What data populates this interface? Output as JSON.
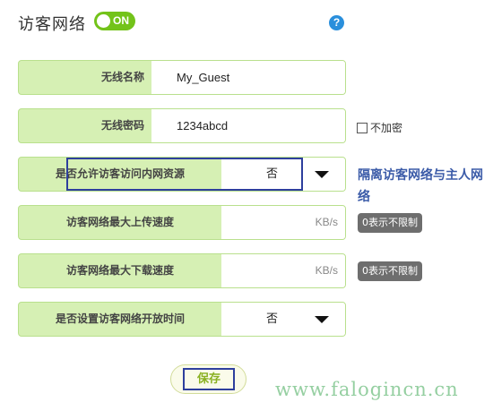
{
  "header": {
    "title": "访客网络",
    "toggle_label": "ON",
    "help_icon": "?"
  },
  "fields": {
    "ssid": {
      "label": "无线名称",
      "value": "My_Guest"
    },
    "password": {
      "label": "无线密码",
      "value": "1234abcd"
    },
    "allow_lan": {
      "label": "是否允许访客访问内网资源",
      "value": "否"
    },
    "upload": {
      "label": "访客网络最大上传速度",
      "value": "",
      "unit": "KB/s",
      "hint": "0表示不限制"
    },
    "download": {
      "label": "访客网络最大下载速度",
      "value": "",
      "unit": "KB/s",
      "hint": "0表示不限制"
    },
    "schedule": {
      "label": "是否设置访客网络开放时间",
      "value": "否"
    }
  },
  "no_encryption": {
    "label": "不加密",
    "checked": false
  },
  "side_note": "隔离访客网络与主人网络",
  "save_label": "保存",
  "watermark": "www.falogincn.cn",
  "colors": {
    "accent_green": "#73c31a",
    "row_green": "#d6f0b4",
    "frame_blue": "#2e3f9d",
    "note_blue": "#3b5ba8"
  }
}
